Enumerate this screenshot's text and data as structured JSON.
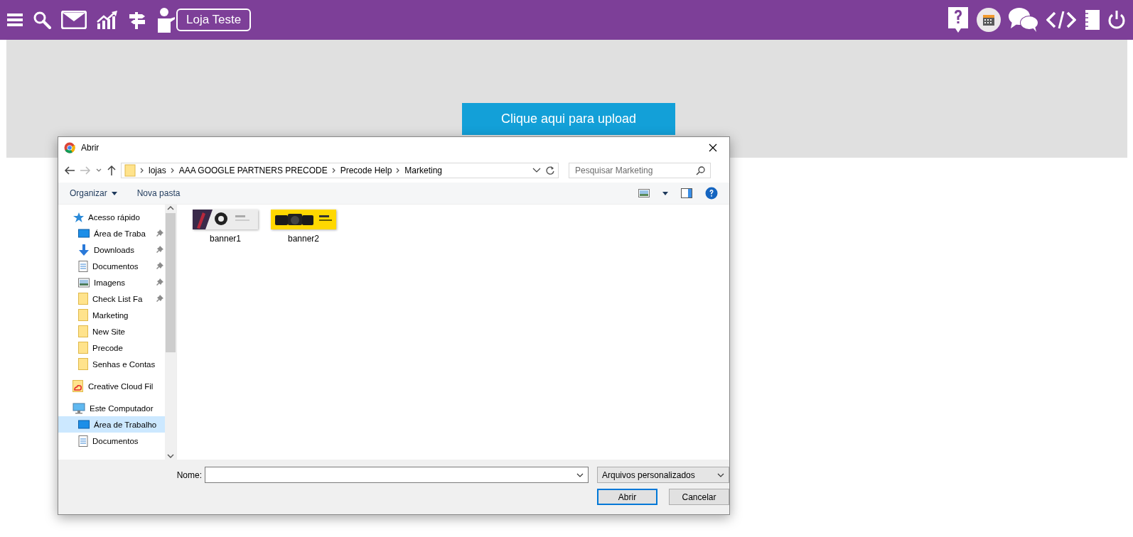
{
  "topbar": {
    "store_button": "Loja Teste"
  },
  "upload_button": "Clique aqui para upload",
  "dialog": {
    "title": "Abrir",
    "path": [
      "lojas",
      "AAA GOOGLE PARTNERS PRECODE",
      "Precode Help",
      "Marketing"
    ],
    "search": {
      "placeholder": "Pesquisar Marketing"
    },
    "toolbar": {
      "organize": "Organizar",
      "new_folder": "Nova pasta"
    },
    "nav": [
      {
        "label": "Acesso rápido",
        "kind": "star",
        "pinned": false,
        "selected": false,
        "children": [
          {
            "label": "Área de Traba",
            "kind": "desktop",
            "pinned": true,
            "selected": false
          },
          {
            "label": "Downloads",
            "kind": "download",
            "pinned": true,
            "selected": false
          },
          {
            "label": "Documentos",
            "kind": "document",
            "pinned": true,
            "selected": false
          },
          {
            "label": "Imagens",
            "kind": "pictures",
            "pinned": true,
            "selected": false
          },
          {
            "label": "Check List Fa",
            "kind": "folder",
            "pinned": true,
            "selected": false
          },
          {
            "label": "Marketing",
            "kind": "folder",
            "pinned": false,
            "selected": false
          },
          {
            "label": "New Site",
            "kind": "folder",
            "pinned": false,
            "selected": false
          },
          {
            "label": "Precode",
            "kind": "folder",
            "pinned": false,
            "selected": false
          },
          {
            "label": "Senhas e Contas",
            "kind": "folder",
            "pinned": false,
            "selected": false
          }
        ]
      },
      {
        "label": "Creative Cloud Fil",
        "kind": "cloud",
        "pinned": false,
        "selected": false
      },
      {
        "label": "Este Computador",
        "kind": "computer",
        "pinned": false,
        "selected": false,
        "children": [
          {
            "label": "Área de Trabalho",
            "kind": "desktop",
            "pinned": false,
            "selected": true
          },
          {
            "label": "Documentos",
            "kind": "document",
            "pinned": false,
            "selected": false
          }
        ]
      }
    ],
    "files": [
      {
        "name": "banner1",
        "kind": "picture"
      },
      {
        "name": "banner2",
        "kind": "picture"
      }
    ],
    "filename": {
      "label": "Nome:"
    },
    "file_type": "Arquivos personalizados",
    "buttons": [
      {
        "label": "Abrir",
        "default": true
      },
      {
        "label": "Cancelar",
        "default": false
      }
    ]
  }
}
